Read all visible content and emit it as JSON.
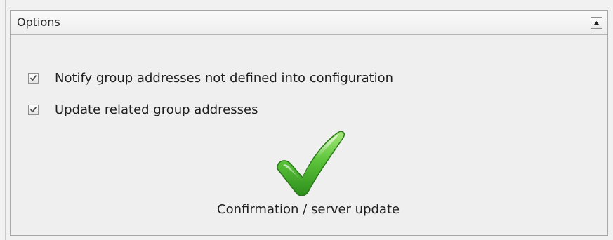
{
  "options_panel": {
    "title": "Options",
    "collapse_icon": "triangle-up-icon",
    "checkboxes": [
      {
        "label": "Notify group addresses not defined into configuration",
        "checked": true
      },
      {
        "label": "Update related group addresses",
        "checked": true
      }
    ],
    "confirmation": {
      "icon": "green-checkmark-icon",
      "label": "Confirmation / server update",
      "icon_color": "#3fae2a"
    }
  }
}
